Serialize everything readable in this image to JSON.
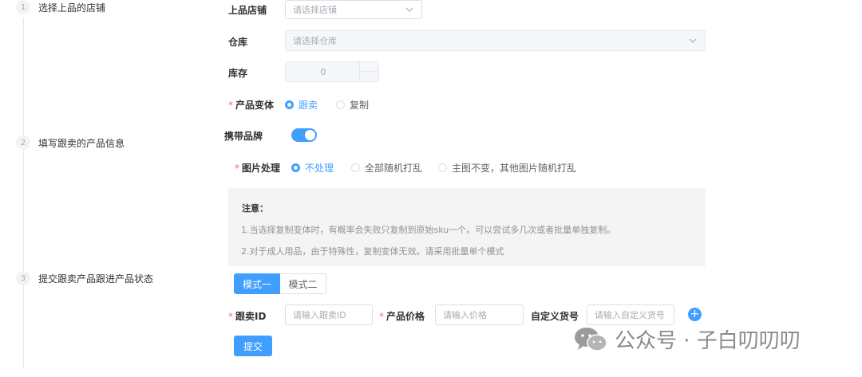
{
  "steps": [
    {
      "num": "1",
      "label": "选择上品的店铺"
    },
    {
      "num": "2",
      "label": "填写跟卖的产品信息"
    },
    {
      "num": "3",
      "label": "提交跟卖产品跟进产品状态"
    }
  ],
  "form": {
    "shop": {
      "label": "上品店铺",
      "placeholder": "请选择店铺"
    },
    "warehouse": {
      "label": "仓库",
      "placeholder": "请选择仓库"
    },
    "stock": {
      "label": "库存",
      "value": "0"
    },
    "variant": {
      "required": "*",
      "label": "产品变体",
      "options": [
        "跟卖",
        "复制"
      ],
      "selected": "跟卖"
    },
    "brand": {
      "label": "携带品牌",
      "on": true
    },
    "image": {
      "required": "*",
      "label": "图片处理",
      "options": [
        "不处理",
        "全部随机打乱",
        "主图不变，其他图片随机打乱"
      ],
      "selected": "不处理"
    },
    "notice": {
      "title": "注意：",
      "line1": "1.当选择复制变体时，有概率会失败只复制到原始sku一个。可以尝试多几次或者批量单独复制。",
      "line2": "2.对于成人用品，由于特殊性，复制变体无效。请采用批量单个模式"
    },
    "modes": {
      "tabs": [
        "模式一",
        "模式二"
      ],
      "active": "模式一"
    },
    "follow_id": {
      "required": "*",
      "label": "跟卖ID",
      "placeholder": "请输入跟卖ID"
    },
    "price": {
      "required": "*",
      "label": "产品价格",
      "placeholder": "请输入价格"
    },
    "sku": {
      "label": "自定义货号",
      "placeholder": "请输入自定义货号"
    },
    "add_icon": "plus-icon",
    "submit_label": "提交"
  },
  "watermark": {
    "text": "公众号 · 子白叨叨叨",
    "icon": "wechat-icon"
  },
  "colors": {
    "primary": "#409eff",
    "required": "#f56c6c",
    "notice_bg": "#f4f4f5"
  }
}
